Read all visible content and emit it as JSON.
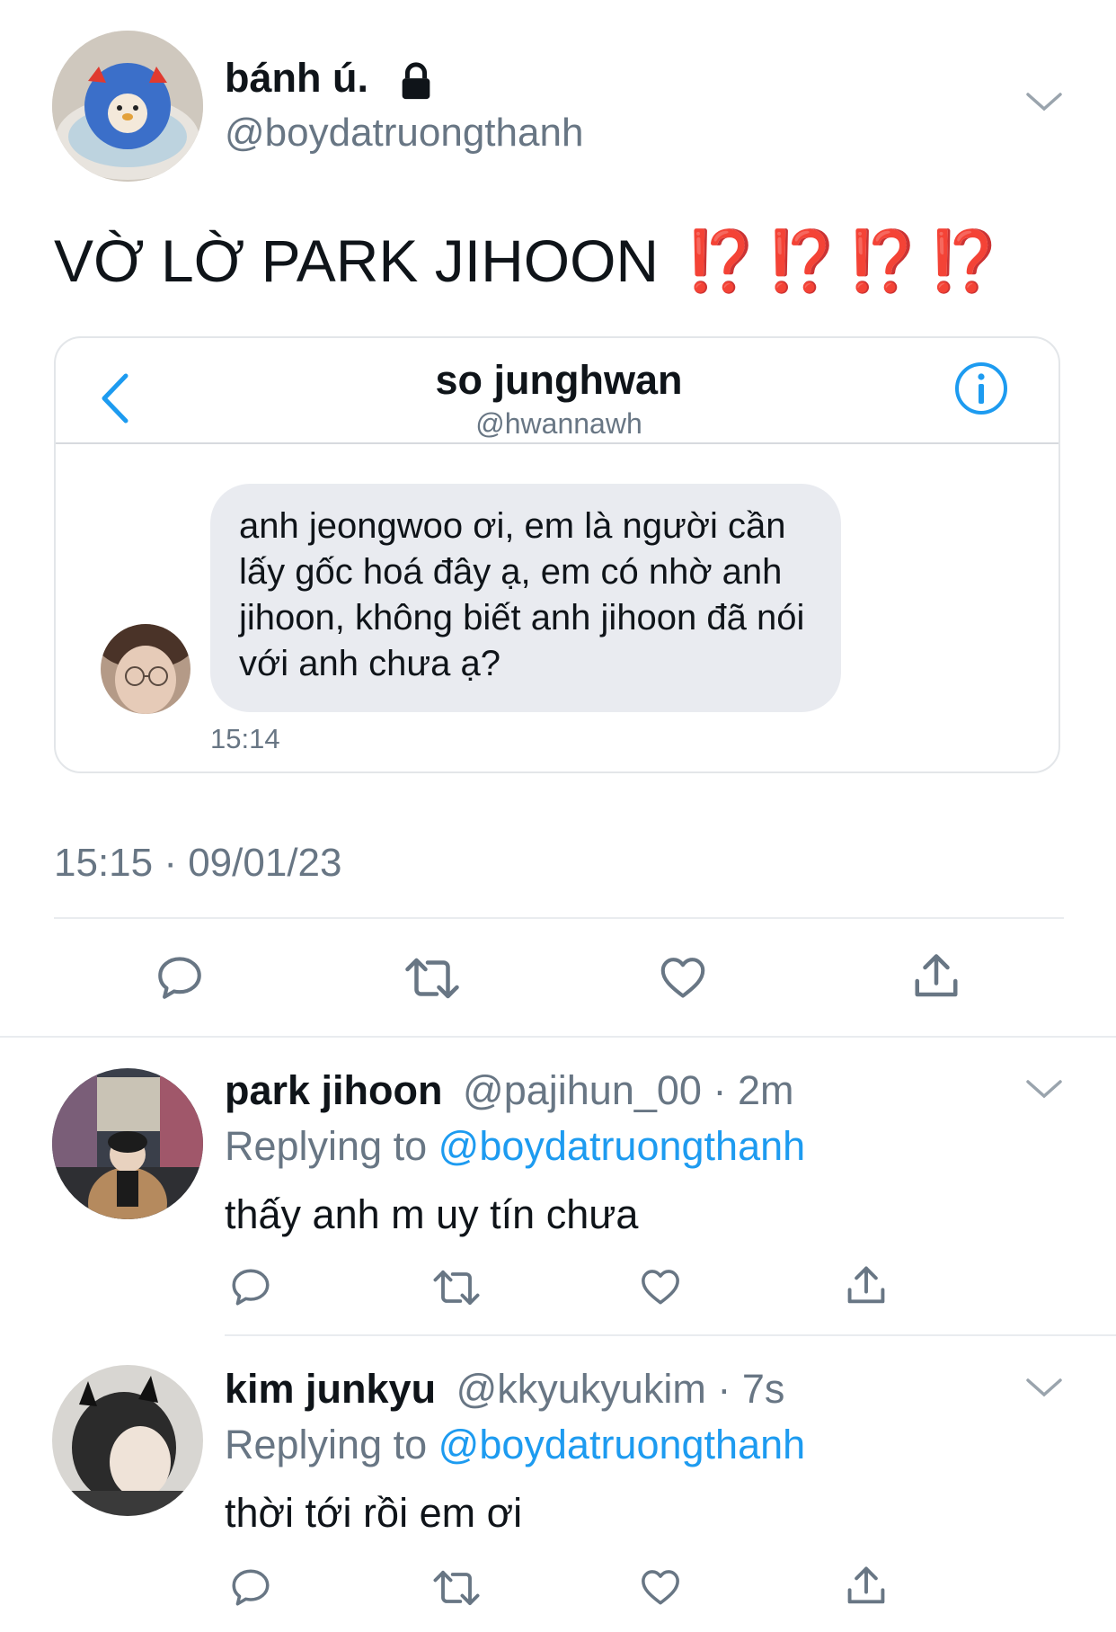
{
  "main_tweet": {
    "display_name": "bánh ú.",
    "handle": "@boydatruongthanh",
    "text": "VỜ LỜ PARK JIHOON",
    "emoji": "⁉️⁉️⁉️⁉️",
    "timestamp": "15:15 · 09/01/23"
  },
  "embedded_dm": {
    "name": "so junghwan",
    "handle": "@hwannawh",
    "message": "anh jeongwoo ơi, em là người cần lấy gốc hoá đây ạ, em có nhờ anh jihoon, không biết anh jihoon đã nói với anh chưa ạ?",
    "message_time": "15:14"
  },
  "replies": [
    {
      "display_name": "park jihoon",
      "handle": "@pajihun_00",
      "time": "· 2m",
      "replying_prefix": "Replying to",
      "replying_handle": "@boydatruongthanh",
      "text": "thấy anh m uy tín chưa"
    },
    {
      "display_name": "kim junkyu",
      "handle": "@kkyukyukim",
      "time": "· 7s",
      "replying_prefix": "Replying to",
      "replying_handle": "@boydatruongthanh",
      "text": "thời tới rồi em ơi"
    }
  ],
  "colors": {
    "accent": "#1d9bf0",
    "muted": "#687684",
    "emoji_red": "#e0392b",
    "bubble": "#e9ebf0"
  },
  "icons": [
    "lock-icon",
    "chevron-down-icon",
    "back-arrow-icon",
    "info-icon",
    "reply-icon",
    "retweet-icon",
    "like-icon",
    "share-icon"
  ]
}
